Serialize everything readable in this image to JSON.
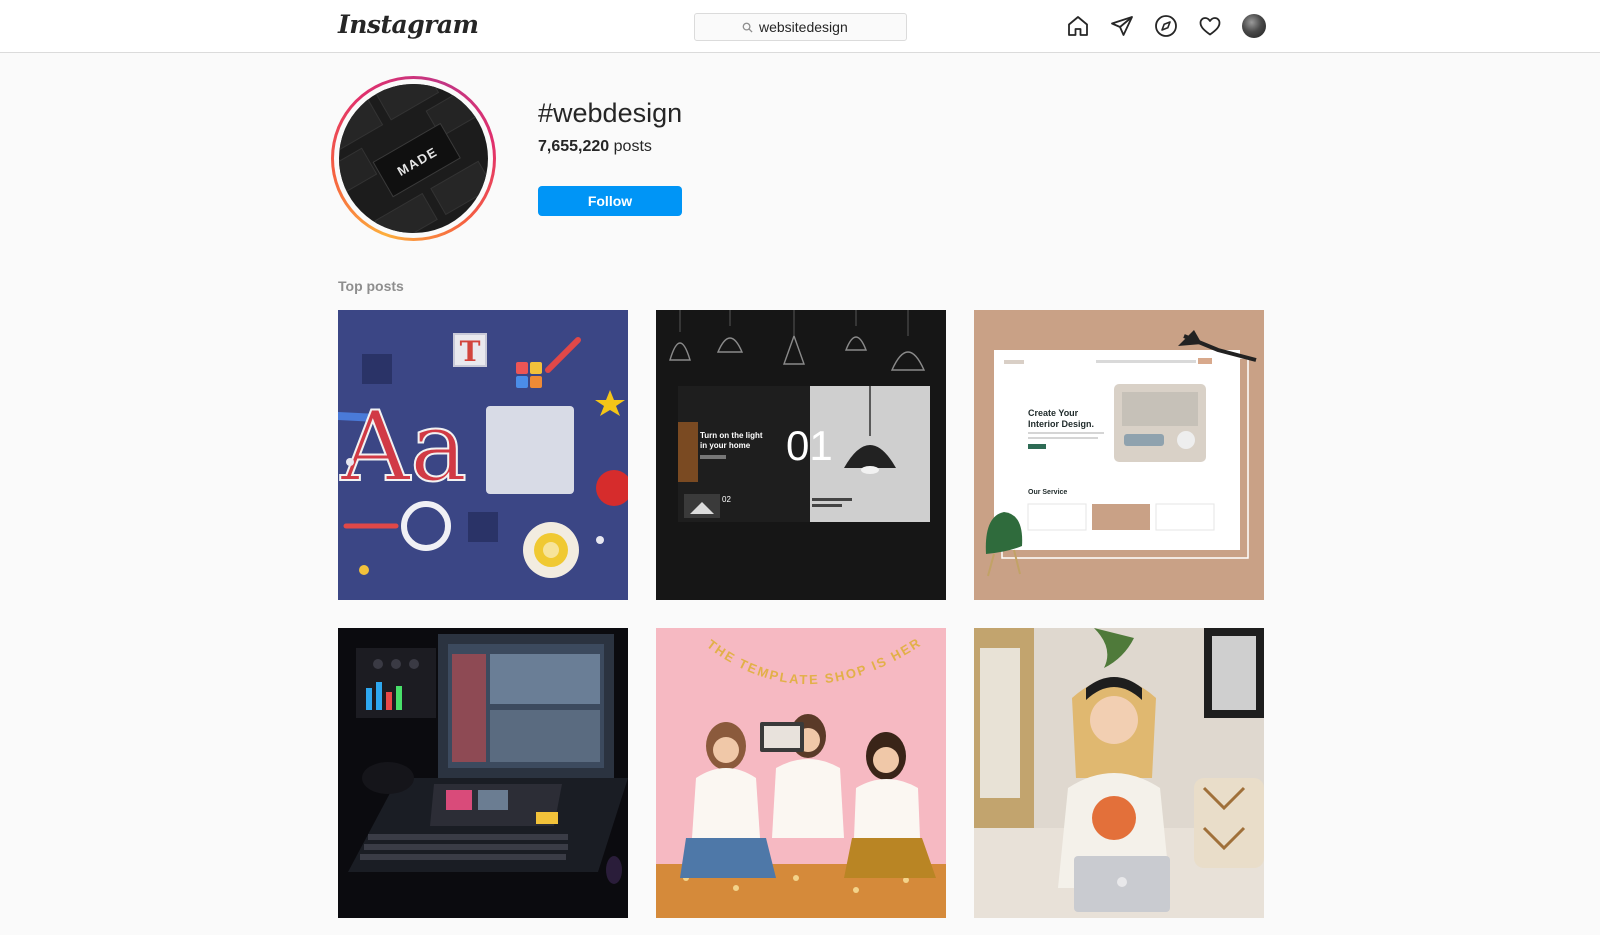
{
  "header": {
    "logo_text": "Instagram",
    "search": {
      "value": "websitedesign",
      "placeholder": "Search"
    },
    "nav_icons": [
      "home-icon",
      "direct-send-icon",
      "explore-compass-icon",
      "activity-heart-icon",
      "profile-avatar"
    ]
  },
  "hashtag": {
    "name": "#webdesign",
    "posts_number": "7,655,220",
    "posts_label": "posts",
    "follow_label": "Follow",
    "profile_image_text": "MADE"
  },
  "top_posts": {
    "title": "Top posts",
    "posts": [
      {
        "id": "typography-3d",
        "letters": "Aa",
        "mini_letter": "T"
      },
      {
        "id": "lamp-website",
        "headline_1": "Turn on the light",
        "headline_2": "in your home",
        "big_number": "01",
        "small_number": "02"
      },
      {
        "id": "interior-website",
        "headline_1": "Create Your",
        "headline_2": "Interior Design.",
        "section": "Our Service"
      },
      {
        "id": "laptop-music-studio"
      },
      {
        "id": "template-shop-team",
        "banner": "THE TEMPLATE SHOP IS HERE"
      },
      {
        "id": "woman-laptop-sofa"
      }
    ]
  },
  "colors": {
    "accent": "#0095f6",
    "ring_start": "#fdae3c",
    "ring_end": "#c13584",
    "secondary_text": "#8e8e8e"
  }
}
